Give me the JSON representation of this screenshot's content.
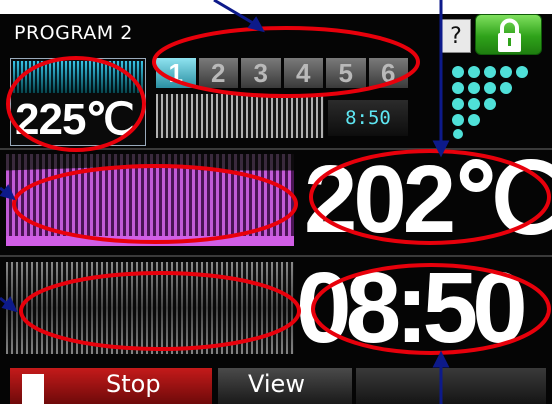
{
  "header": {
    "title": "PROGRAM 2",
    "help_label": "?"
  },
  "icons": {
    "lock": "lock-icon",
    "program": "dots-program-icon",
    "stop": "stop-square-icon"
  },
  "set_temperature": "225℃",
  "steps": [
    "1",
    "2",
    "3",
    "4",
    "5",
    "6"
  ],
  "active_step": "1",
  "step_time": "8:50",
  "current_temperature": "202℃",
  "current_time": "08:50",
  "buttons": {
    "stop": "Stop",
    "view": "View"
  },
  "colors": {
    "annotation": "#e8000b",
    "lock_button": "#33aa1e",
    "stop_button": "#b01414",
    "time_text": "#5ee6f2",
    "temp_graph": "#c15ad6"
  }
}
